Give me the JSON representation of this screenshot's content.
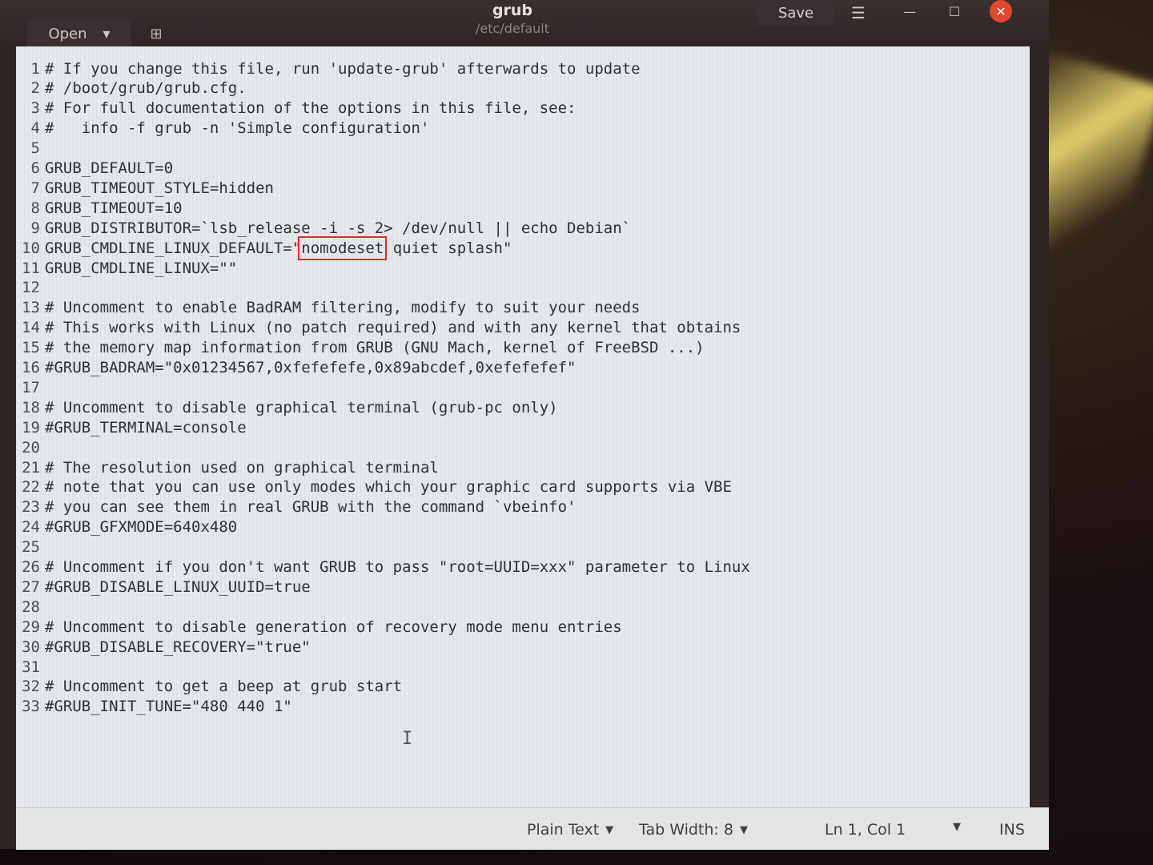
{
  "header": {
    "open_label": "Open",
    "open_caret_icon": "chevron-down-icon",
    "new_tab_icon": "new-document-icon",
    "title": "grub",
    "subtitle": "/etc/default",
    "save_label": "Save",
    "menu_icon": "hamburger-menu-icon",
    "close_color": "#e0482e"
  },
  "editor": {
    "lines": [
      {
        "n": "1",
        "text": "# If you change this file, run 'update-grub' afterwards to update"
      },
      {
        "n": "2",
        "text": "# /boot/grub/grub.cfg."
      },
      {
        "n": "3",
        "text": "# For full documentation of the options in this file, see:"
      },
      {
        "n": "4",
        "text": "#   info -f grub -n 'Simple configuration'"
      },
      {
        "n": "5",
        "text": ""
      },
      {
        "n": "6",
        "text": "GRUB_DEFAULT=0"
      },
      {
        "n": "7",
        "text": "GRUB_TIMEOUT_STYLE=hidden"
      },
      {
        "n": "8",
        "text": "GRUB_TIMEOUT=10"
      },
      {
        "n": "9",
        "text": "GRUB_DISTRIBUTOR=`lsb_release -i -s 2> /dev/null || echo Debian`"
      },
      {
        "n": "10",
        "text_before": "GRUB_CMDLINE_LINUX_DEFAULT=\"",
        "highlight": "nomodeset",
        "text_after": " quiet splash\""
      },
      {
        "n": "11",
        "text": "GRUB_CMDLINE_LINUX=\"\""
      },
      {
        "n": "12",
        "text": ""
      },
      {
        "n": "13",
        "text": "# Uncomment to enable BadRAM filtering, modify to suit your needs"
      },
      {
        "n": "14",
        "text": "# This works with Linux (no patch required) and with any kernel that obtains"
      },
      {
        "n": "15",
        "text": "# the memory map information from GRUB (GNU Mach, kernel of FreeBSD ...)"
      },
      {
        "n": "16",
        "text": "#GRUB_BADRAM=\"0x01234567,0xfefefefe,0x89abcdef,0xefefefef\""
      },
      {
        "n": "17",
        "text": ""
      },
      {
        "n": "18",
        "text": "# Uncomment to disable graphical terminal (grub-pc only)"
      },
      {
        "n": "19",
        "text": "#GRUB_TERMINAL=console"
      },
      {
        "n": "20",
        "text": ""
      },
      {
        "n": "21",
        "text": "# The resolution used on graphical terminal"
      },
      {
        "n": "22",
        "text": "# note that you can use only modes which your graphic card supports via VBE"
      },
      {
        "n": "23",
        "text": "# you can see them in real GRUB with the command `vbeinfo'"
      },
      {
        "n": "24",
        "text": "#GRUB_GFXMODE=640x480"
      },
      {
        "n": "25",
        "text": ""
      },
      {
        "n": "26",
        "text": "# Uncomment if you don't want GRUB to pass \"root=UUID=xxx\" parameter to Linux"
      },
      {
        "n": "27",
        "text": "#GRUB_DISABLE_LINUX_UUID=true"
      },
      {
        "n": "28",
        "text": ""
      },
      {
        "n": "29",
        "text": "# Uncomment to disable generation of recovery mode menu entries"
      },
      {
        "n": "30",
        "text": "#GRUB_DISABLE_RECOVERY=\"true\""
      },
      {
        "n": "31",
        "text": ""
      },
      {
        "n": "32",
        "text": "# Uncomment to get a beep at grub start"
      },
      {
        "n": "33",
        "text": "#GRUB_INIT_TUNE=\"480 440 1\""
      }
    ],
    "highlight_color": "#e32b2b"
  },
  "status": {
    "language": "Plain Text",
    "tab_width": "Tab Width: 8",
    "position": "Ln 1, Col 1",
    "mode": "INS"
  }
}
